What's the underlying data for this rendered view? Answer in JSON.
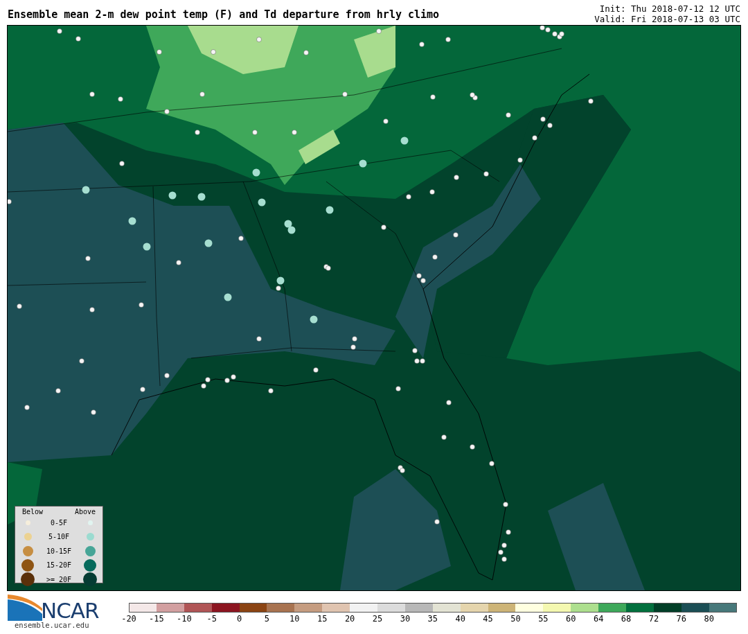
{
  "header": {
    "title": "Ensemble mean 2-m dew point temp (F) and Td departure from hrly climo",
    "init": "Init: Thu 2018-07-12 12 UTC",
    "valid": "Valid: Fri 2018-07-13 03 UTC"
  },
  "legend": {
    "below_heading": "Below",
    "above_heading": "Above",
    "rows": [
      {
        "label": "0-5F",
        "below": {
          "color": "#f6eedb"
        },
        "above": {
          "color": "#e1f4f0"
        }
      },
      {
        "label": "5-10F",
        "below": {
          "color": "#ecd292"
        },
        "above": {
          "color": "#9bdbd0"
        }
      },
      {
        "label": "10-15F",
        "below": {
          "color": "#c68e42"
        },
        "above": {
          "color": "#47a597"
        }
      },
      {
        "label": "15-20F",
        "below": {
          "color": "#8e5413"
        },
        "above": {
          "color": "#066a5c"
        }
      },
      {
        "label": ">= 20F",
        "below": {
          "color": "#5a300a"
        },
        "above": {
          "color": "#053c33"
        }
      }
    ]
  },
  "colorbar": {
    "segments": [
      {
        "color": "#f4e8e8",
        "label": "-20"
      },
      {
        "color": "#d29fa0",
        "label": "-15"
      },
      {
        "color": "#b05556",
        "label": "-10"
      },
      {
        "color": "#8c1520",
        "label": "-5"
      },
      {
        "color": "#8b4413",
        "label": "0"
      },
      {
        "color": "#a87350",
        "label": "5"
      },
      {
        "color": "#c59c80",
        "label": "10"
      },
      {
        "color": "#e0c4b0",
        "label": "15"
      },
      {
        "color": "#f2f2f2",
        "label": "20"
      },
      {
        "color": "#dcdcdc",
        "label": "25"
      },
      {
        "color": "#b8b8b8",
        "label": "30"
      },
      {
        "color": "#e3e3d4",
        "label": "35"
      },
      {
        "color": "#e5d5ad",
        "label": "40"
      },
      {
        "color": "#cdb477",
        "label": "45"
      },
      {
        "color": "#ffffe0",
        "label": "50"
      },
      {
        "color": "#f4f8b0",
        "label": "55"
      },
      {
        "color": "#addf8e",
        "label": "60"
      },
      {
        "color": "#3ea85a",
        "label": "64"
      },
      {
        "color": "#03703e",
        "label": "68"
      },
      {
        "color": "#023f28",
        "label": "72"
      },
      {
        "color": "#1b4e55",
        "label": "76"
      },
      {
        "color": "#47787a",
        "label": "80"
      }
    ]
  },
  "footer": {
    "logo_text": "NCAR",
    "url": "ensemble.ucar.edu"
  }
}
